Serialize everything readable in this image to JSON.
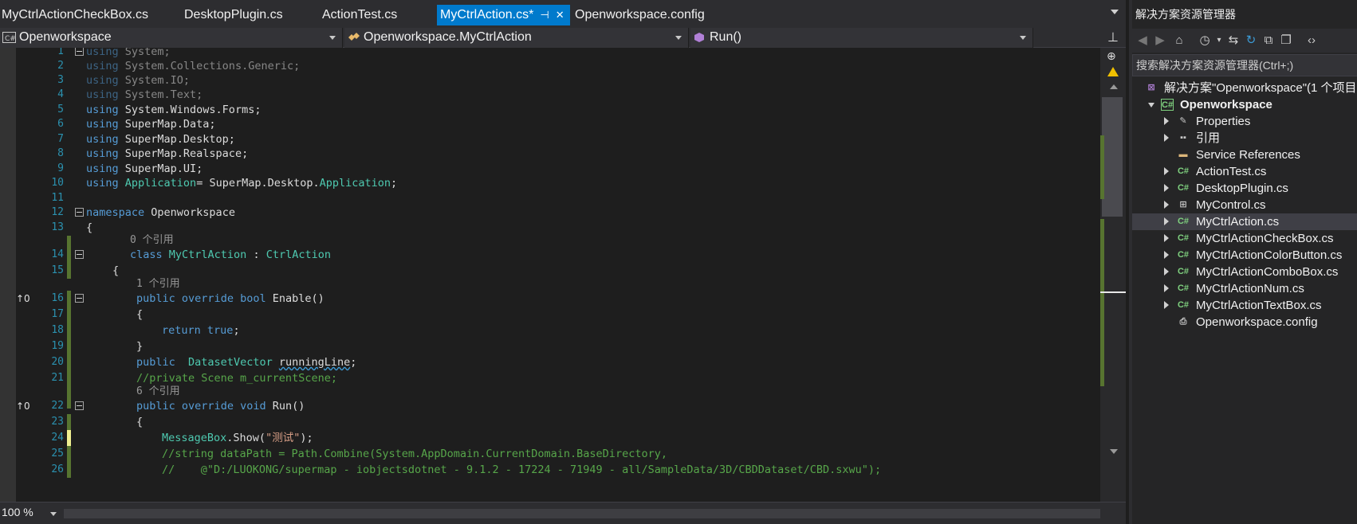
{
  "tabs": [
    {
      "label": "MyCtrlActionCheckBox.cs",
      "active": false
    },
    {
      "label": "DesktopPlugin.cs",
      "active": false
    },
    {
      "label": "ActionTest.cs",
      "active": false
    },
    {
      "label": "MyCtrlAction.cs*",
      "active": true,
      "pin": "⊣",
      "close": "✕"
    },
    {
      "label": "Openworkspace.config",
      "active": false
    }
  ],
  "nav": {
    "project": "Openworkspace",
    "class": "Openworkspace.MyCtrlAction",
    "member": "Run()"
  },
  "code": {
    "lines": [
      {
        "n": "1",
        "text": "using System;"
      },
      {
        "n": "2",
        "text": "using System.Collections.Generic;"
      },
      {
        "n": "3",
        "text": "using System.IO;"
      },
      {
        "n": "4",
        "text": "using System.Text;"
      },
      {
        "n": "5",
        "text": "using System.Windows.Forms;"
      },
      {
        "n": "6",
        "text": "using SuperMap.Data;"
      },
      {
        "n": "7",
        "text": "using SuperMap.Desktop;"
      },
      {
        "n": "8",
        "text": "using SuperMap.Realspace;"
      },
      {
        "n": "9",
        "text": "using SuperMap.UI;"
      },
      {
        "n": "10",
        "text": "using Application= SuperMap.Desktop.Application;"
      },
      {
        "n": "11",
        "text": ""
      },
      {
        "n": "12",
        "text": "namespace Openworkspace"
      },
      {
        "n": "13",
        "text": "{"
      },
      {
        "n": "14",
        "text": "class MyCtrlAction : CtrlAction"
      },
      {
        "n": "15",
        "text": "{"
      },
      {
        "n": "16",
        "text": "public override bool Enable()"
      },
      {
        "n": "17",
        "text": "{"
      },
      {
        "n": "18",
        "text": "return true;"
      },
      {
        "n": "19",
        "text": "}"
      },
      {
        "n": "20",
        "text": "public  DatasetVector runningLine;"
      },
      {
        "n": "21",
        "text": "//private Scene m_currentScene;"
      },
      {
        "n": "22",
        "text": "public override void Run()"
      },
      {
        "n": "23",
        "text": "{"
      },
      {
        "n": "24",
        "text": "MessageBox.Show(\"测试\");"
      },
      {
        "n": "25",
        "text": "//string dataPath = Path.Combine(System.AppDomain.CurrentDomain.BaseDirectory,"
      },
      {
        "n": "26",
        "text": "//    @\"D:/LUOKONG/supermap - iobjectsdotnet - 9.1.2 - 17224 - 71949 - all/SampleData/3D/CBDDataset/CBD.sxwu\");"
      }
    ],
    "lens": [
      "0 个引用",
      "1 个引用",
      "6 个引用"
    ],
    "override_marker": "↑0"
  },
  "zoom": "100 %",
  "solution": {
    "title": "解决方案资源管理器",
    "search_placeholder": "搜索解决方案资源管理器(Ctrl+;)",
    "solution_label": "解决方案\"Openworkspace\"(1 个项目",
    "project": "Openworkspace",
    "items": [
      {
        "label": "Properties"
      },
      {
        "label": "引用"
      },
      {
        "label": "Service References"
      },
      {
        "label": "ActionTest.cs"
      },
      {
        "label": "DesktopPlugin.cs"
      },
      {
        "label": "MyControl.cs"
      },
      {
        "label": "MyCtrlAction.cs"
      },
      {
        "label": "MyCtrlActionCheckBox.cs"
      },
      {
        "label": "MyCtrlActionColorButton.cs"
      },
      {
        "label": "MyCtrlActionComboBox.cs"
      },
      {
        "label": "MyCtrlActionNum.cs"
      },
      {
        "label": "MyCtrlActionTextBox.cs"
      },
      {
        "label": "Openworkspace.config"
      }
    ]
  },
  "colors": {
    "accent": "#007acc",
    "keyword": "#569cd6",
    "type": "#4ec9b0",
    "string": "#d69d85",
    "comment": "#57a64a",
    "line_number": "#2b91af"
  }
}
